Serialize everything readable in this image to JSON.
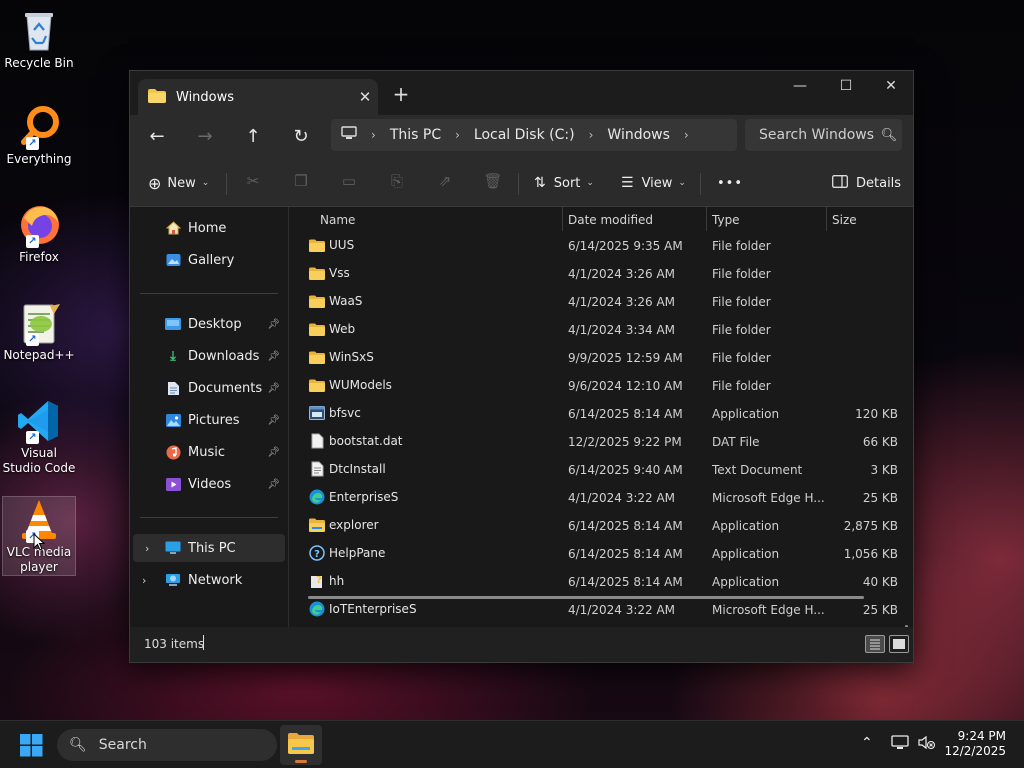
{
  "desktop": {
    "icons": [
      {
        "label": "Recycle Bin"
      },
      {
        "label": "Everything"
      },
      {
        "label": "Firefox"
      },
      {
        "label": "Notepad++"
      },
      {
        "label": "Visual Studio Code"
      },
      {
        "label": "VLC media player"
      }
    ]
  },
  "window": {
    "tab_title": "Windows",
    "tab_close": "✕",
    "new_tab": "+",
    "controls": {
      "minimize": "—",
      "maximize": "☐",
      "close": "✕"
    },
    "nav": {
      "back": "←",
      "forward": "→",
      "up": "↑",
      "refresh": "↻"
    },
    "breadcrumb": [
      "This PC",
      "Local Disk (C:)",
      "Windows"
    ],
    "search_placeholder": "Search Windows",
    "toolbar": {
      "new": "New",
      "sort": "Sort",
      "view": "View",
      "more": "•••",
      "details": "Details"
    },
    "sidebar": {
      "top": [
        {
          "label": "Home"
        },
        {
          "label": "Gallery"
        }
      ],
      "pinned": [
        {
          "label": "Desktop"
        },
        {
          "label": "Downloads"
        },
        {
          "label": "Documents"
        },
        {
          "label": "Pictures"
        },
        {
          "label": "Music"
        },
        {
          "label": "Videos"
        }
      ],
      "drives": [
        {
          "label": "This PC"
        },
        {
          "label": "Network"
        }
      ]
    },
    "columns": {
      "name": "Name",
      "date": "Date modified",
      "type": "Type",
      "size": "Size"
    },
    "files": [
      {
        "name": "UUS",
        "date": "6/14/2025 9:35 AM",
        "type": "File folder",
        "size": "",
        "icon": "folder-icon"
      },
      {
        "name": "Vss",
        "date": "4/1/2024 3:26 AM",
        "type": "File folder",
        "size": "",
        "icon": "folder-icon"
      },
      {
        "name": "WaaS",
        "date": "4/1/2024 3:26 AM",
        "type": "File folder",
        "size": "",
        "icon": "folder-icon"
      },
      {
        "name": "Web",
        "date": "4/1/2024 3:34 AM",
        "type": "File folder",
        "size": "",
        "icon": "folder-icon"
      },
      {
        "name": "WinSxS",
        "date": "9/9/2025 12:59 AM",
        "type": "File folder",
        "size": "",
        "icon": "folder-icon"
      },
      {
        "name": "WUModels",
        "date": "9/6/2024 12:10 AM",
        "type": "File folder",
        "size": "",
        "icon": "folder-icon"
      },
      {
        "name": "bfsvc",
        "date": "6/14/2025 8:14 AM",
        "type": "Application",
        "size": "120 KB",
        "icon": "application-icon"
      },
      {
        "name": "bootstat.dat",
        "date": "12/2/2025 9:22 PM",
        "type": "DAT File",
        "size": "66 KB",
        "icon": "file-icon"
      },
      {
        "name": "DtcInstall",
        "date": "6/14/2025 9:40 AM",
        "type": "Text Document",
        "size": "3 KB",
        "icon": "text-file-icon"
      },
      {
        "name": "EnterpriseS",
        "date": "4/1/2024 3:22 AM",
        "type": "Microsoft Edge H...",
        "size": "25 KB",
        "icon": "edge-icon"
      },
      {
        "name": "explorer",
        "date": "6/14/2025 8:14 AM",
        "type": "Application",
        "size": "2,875 KB",
        "icon": "explorer-icon"
      },
      {
        "name": "HelpPane",
        "date": "6/14/2025 8:14 AM",
        "type": "Application",
        "size": "1,056 KB",
        "icon": "help-icon"
      },
      {
        "name": "hh",
        "date": "6/14/2025 8:14 AM",
        "type": "Application",
        "size": "40 KB",
        "icon": "help-viewer-icon"
      },
      {
        "name": "IoTEnterpriseS",
        "date": "4/1/2024 3:22 AM",
        "type": "Microsoft Edge H...",
        "size": "25 KB",
        "icon": "edge-icon"
      }
    ],
    "status": {
      "item_count": "103 items"
    }
  },
  "taskbar": {
    "search_label": "Search",
    "time": "9:24 PM",
    "date": "12/2/2025"
  },
  "colors": {
    "folder": "#f3c548",
    "accent": "#4aa3ff",
    "window_bg": "#202020"
  }
}
